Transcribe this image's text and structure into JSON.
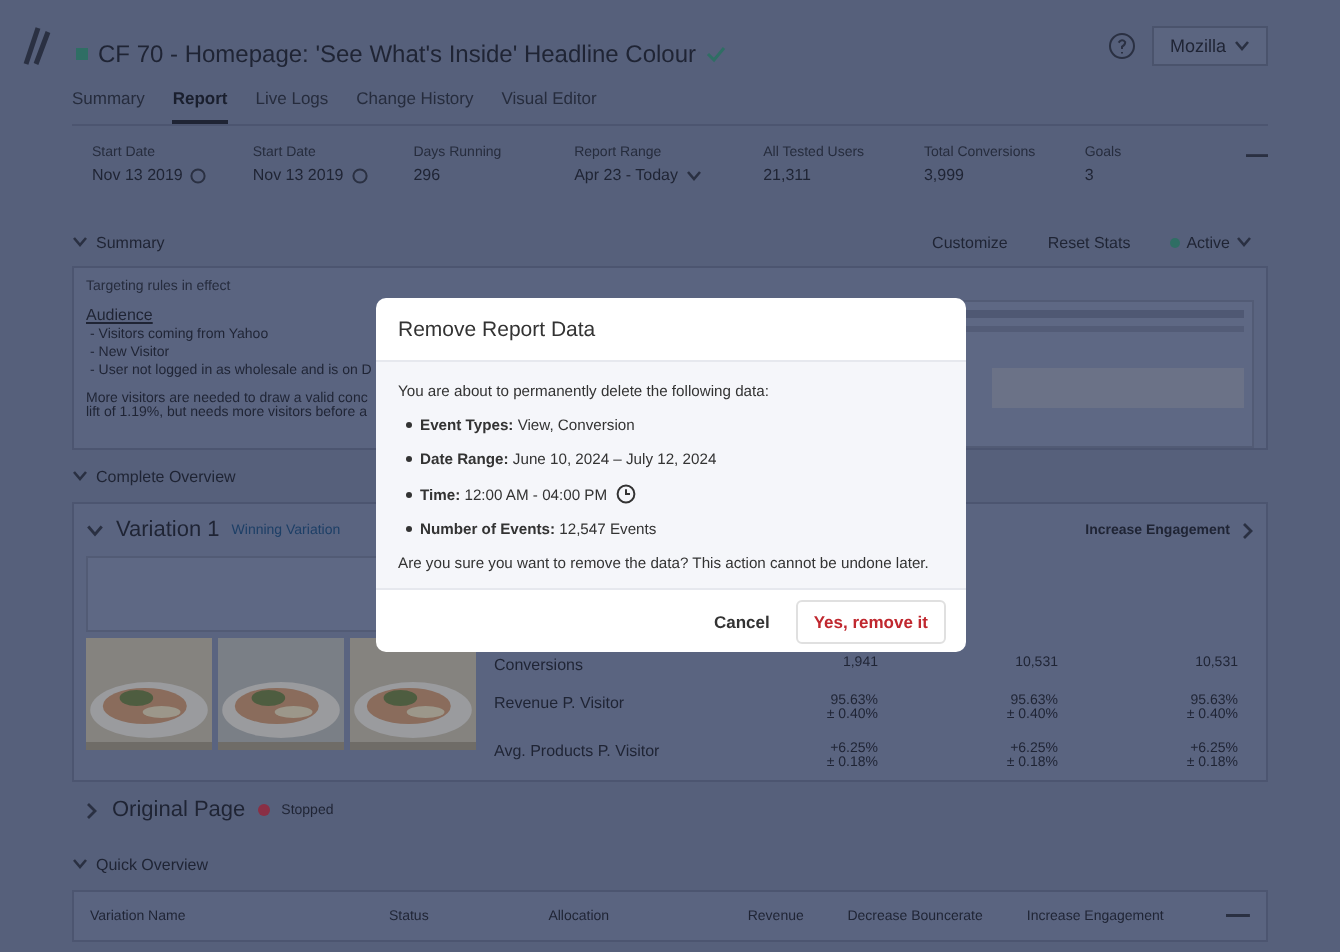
{
  "header": {
    "title": "CF 70 - Homepage: 'See What's Inside' Headline Colour",
    "account": "Mozilla"
  },
  "tabs": [
    {
      "label": "Summary",
      "selected": false
    },
    {
      "label": "Report",
      "selected": true
    },
    {
      "label": "Live Logs",
      "selected": false
    },
    {
      "label": "Change History",
      "selected": false
    },
    {
      "label": "Visual Editor",
      "selected": false
    }
  ],
  "stats": [
    {
      "label": "Start Date",
      "value": "Nov 13 2019",
      "kind": "info"
    },
    {
      "label": "Start Date",
      "value": "Nov 13 2019",
      "kind": "info"
    },
    {
      "label": "Days Running",
      "value": "296",
      "kind": "plain"
    },
    {
      "label": "Report Range",
      "value": "Apr 23 - Today",
      "kind": "dropdown"
    },
    {
      "label": "All Tested Users",
      "value": "21,311",
      "kind": "plain"
    },
    {
      "label": "Total Conversions",
      "value": "3,999",
      "kind": "plain"
    },
    {
      "label": "Goals",
      "value": "3",
      "kind": "plain"
    }
  ],
  "summary": {
    "title": "Summary",
    "customize": "Customize",
    "reset": "Reset Stats",
    "status": "Active",
    "rules_title": "Targeting rules in effect",
    "audience": "Audience",
    "audience_items": [
      "- Visitors coming from Yahoo",
      "- New Visitor",
      "- User not logged in as wholesale and is on D"
    ],
    "note_lines": [
      "More visitors are needed to draw a valid conc",
      "lift of 1.19%, but needs more visitors before a"
    ]
  },
  "complete_overview": {
    "title": "Complete Overview",
    "variation": {
      "name": "Variation 1",
      "tag": "Winning Variation",
      "column_header": "Increase Engagement",
      "metrics": [
        {
          "label": "Conversions",
          "values": [
            [
              "1,941"
            ],
            [
              "10,531"
            ],
            [
              "10,531"
            ]
          ]
        },
        {
          "label": "Revenue P. Visitor",
          "values": [
            [
              "95.63%",
              "± 0.40%"
            ],
            [
              "95.63%",
              "± 0.40%"
            ],
            [
              "95.63%",
              "± 0.40%"
            ]
          ]
        },
        {
          "label": "Avg. Products P. Visitor",
          "values": [
            [
              "+6.25%",
              "± 0.18%"
            ],
            [
              "+6.25%",
              "± 0.18%"
            ],
            [
              "+6.25%",
              "± 0.18%"
            ]
          ]
        }
      ]
    },
    "original": {
      "name": "Original Page",
      "status": "Stopped",
      "expanded": false
    }
  },
  "quick_overview": {
    "title": "Quick Overview",
    "columns": [
      "Variation Name",
      "Status",
      "Allocation",
      "Revenue",
      "Decrease Bouncerate",
      "Increase Engagement"
    ]
  },
  "dialog": {
    "title": "Remove Report Data",
    "intro": "You are about to permanently delete the following data:",
    "items": [
      {
        "label": "Event Types:",
        "value": "View, Conversion",
        "clock_icon": false
      },
      {
        "label": "Date Range:",
        "value": "June 10, 2024 – July 12, 2024",
        "clock_icon": false
      },
      {
        "label": "Time:",
        "value": "12:00 AM - 04:00 PM",
        "clock_icon": true
      },
      {
        "label": "Number of Events:",
        "value": "12,547 Events",
        "clock_icon": false
      }
    ],
    "question": "Are you sure you want to remove the data? This action cannot be undone later.",
    "cancel": "Cancel",
    "confirm": "Yes, remove it"
  }
}
